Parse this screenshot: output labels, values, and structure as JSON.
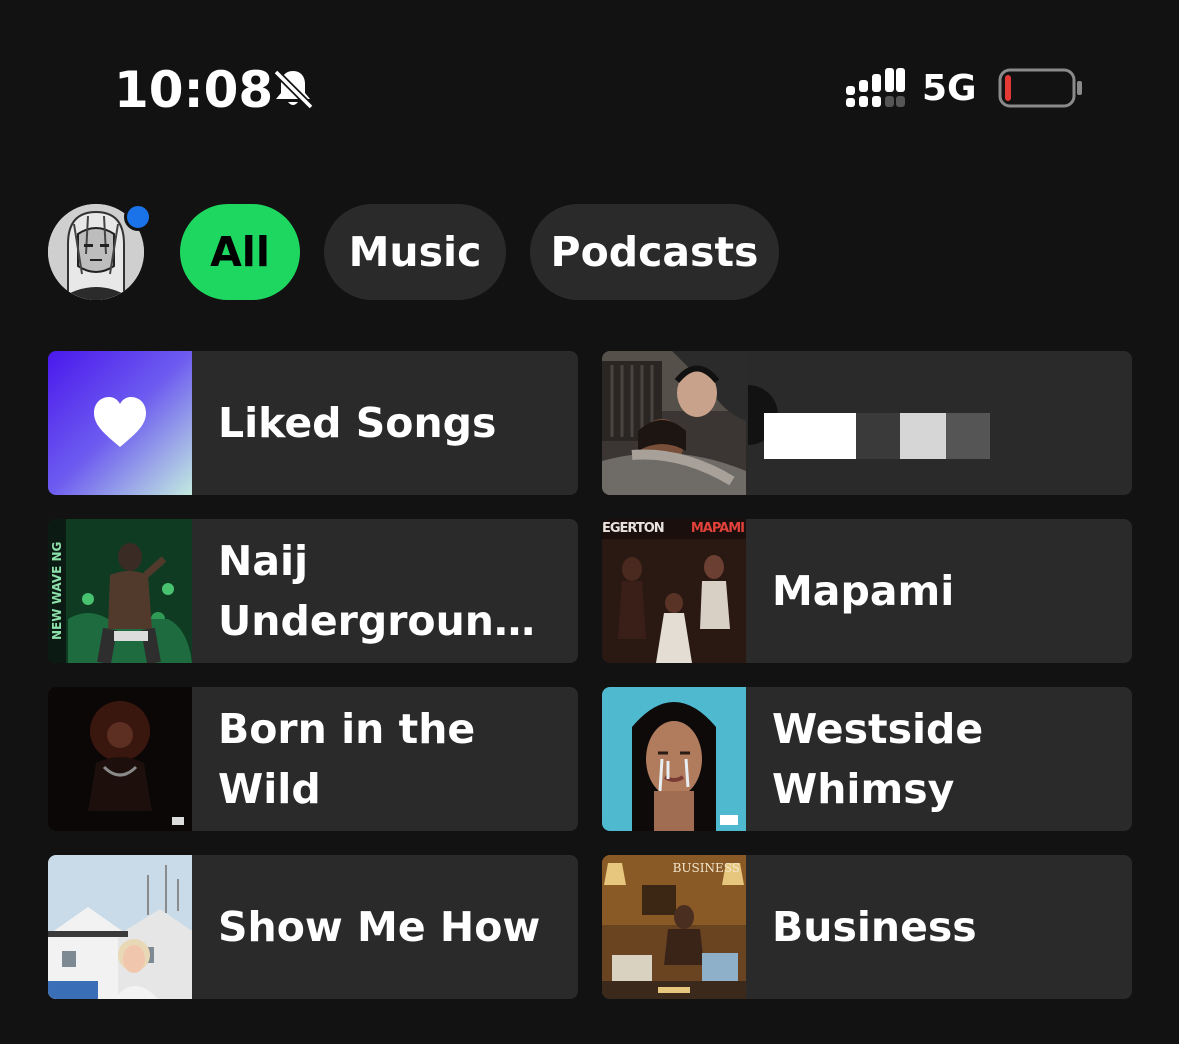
{
  "status_bar": {
    "time": "10:08",
    "network": "5G",
    "battery_level": 0.1,
    "battery_color": "#e53935",
    "icons": [
      "bell-slash-icon",
      "signal-icon",
      "battery-icon"
    ]
  },
  "filters": {
    "items": [
      {
        "label": "All",
        "active": true
      },
      {
        "label": "Music",
        "active": false
      },
      {
        "label": "Podcasts",
        "active": false
      }
    ],
    "accent": "#1ed760",
    "notification_dot_color": "#1a73e8"
  },
  "library": {
    "items": [
      {
        "title": "Liked Songs",
        "icon": "heart-icon"
      },
      {
        "title": ""
      },
      {
        "title": "Naij Undergroun…"
      },
      {
        "title": "Mapami",
        "art_text_left": "EGERTON",
        "art_text_right": "MAPAMI"
      },
      {
        "title": "Born in the Wild"
      },
      {
        "title": "Westside Whimsy"
      },
      {
        "title": "Show Me How"
      },
      {
        "title": "Business",
        "art_text": "BUSINESS"
      }
    ],
    "naij_art_text": "NEW WAVE NG"
  }
}
